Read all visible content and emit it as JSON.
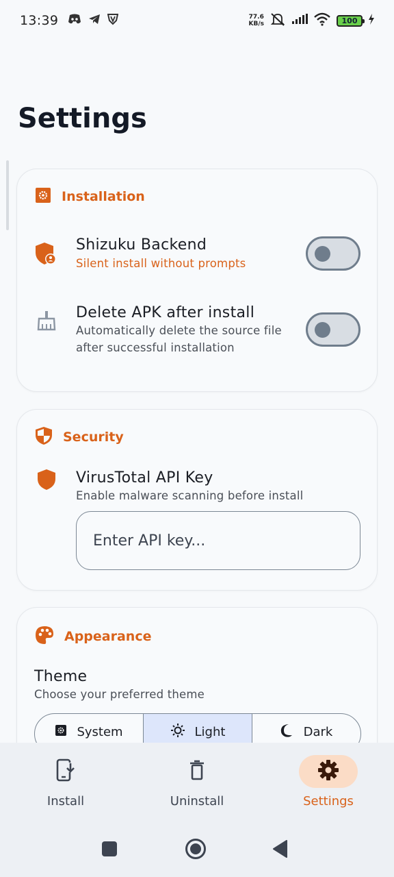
{
  "status_bar": {
    "time": "13:39",
    "net_speed_value": "77.6",
    "net_speed_unit": "KB/s",
    "battery": "100"
  },
  "page": {
    "title": "Settings"
  },
  "installation": {
    "header": "Installation",
    "shizuku": {
      "title": "Shizuku Backend",
      "subtitle": "Silent install without prompts",
      "enabled": false
    },
    "delete_apk": {
      "title": "Delete APK after install",
      "subtitle_line1": "Automatically delete the source file",
      "subtitle_line2": "after successful installation",
      "enabled": false
    }
  },
  "security": {
    "header": "Security",
    "virustotal": {
      "title": "VirusTotal API Key",
      "subtitle": "Enable malware scanning before install",
      "placeholder": "Enter API key...",
      "value": ""
    }
  },
  "appearance": {
    "header": "Appearance",
    "theme_title": "Theme",
    "theme_subtitle": "Choose your preferred theme",
    "options": [
      "System",
      "Light",
      "Dark"
    ],
    "selected": "Light"
  },
  "bottom_nav": {
    "items": [
      {
        "label": "Install",
        "icon": "install-icon"
      },
      {
        "label": "Uninstall",
        "icon": "trash-icon"
      },
      {
        "label": "Settings",
        "icon": "gear-icon"
      }
    ],
    "active": "Settings"
  },
  "colors": {
    "accent": "#d9621a",
    "background": "#f7f9fb",
    "selected_segment": "#dde6fb",
    "active_nav_pill": "#fbdcc6"
  }
}
